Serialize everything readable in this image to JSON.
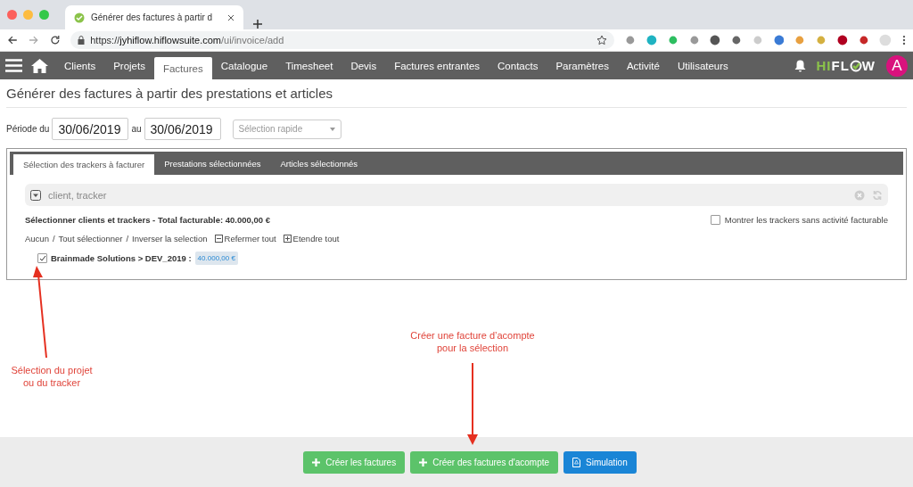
{
  "browser": {
    "tab_title": "Générer des factures à partir d",
    "url_scheme": "https://",
    "url_host": "jyhiflow.hiflowsuite.com",
    "url_path": "/ui/invoice/add"
  },
  "nav": {
    "items": [
      {
        "label": "Clients",
        "selected": false
      },
      {
        "label": "Projets",
        "selected": false
      },
      {
        "label": "Factures",
        "selected": true
      },
      {
        "label": "Catalogue",
        "selected": false
      },
      {
        "label": "Timesheet",
        "selected": false
      },
      {
        "label": "Devis",
        "selected": false
      },
      {
        "label": "Factures entrantes",
        "selected": false
      },
      {
        "label": "Contacts",
        "selected": false
      },
      {
        "label": "Paramètres",
        "selected": false
      },
      {
        "label": "Activité",
        "selected": false
      },
      {
        "label": "Utilisateurs",
        "selected": false
      }
    ],
    "logo_parts": [
      {
        "kind": "text",
        "text": "HI",
        "color": "#8bc34a"
      },
      {
        "kind": "text",
        "text": "FL",
        "color": "#ffffff"
      },
      {
        "kind": "check",
        "color": "#8bc34a"
      },
      {
        "kind": "text",
        "text": "W",
        "color": "#ffffff"
      }
    ],
    "avatar": "A"
  },
  "title": "Générer des factures à partir des prestations et articles",
  "period": {
    "label_from": "Période du",
    "from": "30/06/2019",
    "label_to": "au",
    "to": "30/06/2019",
    "quick_select_placeholder": "Sélection rapide"
  },
  "panel": {
    "tabs": [
      {
        "label": "Sélection des trackers à facturer",
        "selected": true
      },
      {
        "label": "Prestations sélectionnées",
        "selected": false
      },
      {
        "label": "Articles sélectionnés",
        "selected": false
      }
    ],
    "search_placeholder": "client, tracker",
    "summary": "Sélectionner clients et trackers - Total facturable: 40.000,00 €",
    "show_inactive": {
      "label": "Montrer les trackers sans activité facturable",
      "checked": false
    },
    "selection_links": [
      "Aucun",
      "Tout sélectionner",
      "Inverser la selection"
    ],
    "separator": "/",
    "collapse_all": "Refermer tout",
    "expand_all": "Etendre tout",
    "trackers": [
      {
        "label": "Brainmade Solutions > DEV_2019 :",
        "amount": "40.000,00 €",
        "checked": true
      }
    ]
  },
  "annotations": [
    {
      "lines": [
        "Sélection du projet",
        "ou du tracker"
      ],
      "kind": "arrow_up"
    },
    {
      "lines": [
        "Créer une facture d’acompte",
        "pour la sélection"
      ],
      "kind": "arrow_down"
    }
  ],
  "footer_buttons": [
    {
      "label": "Créer les factures",
      "kind": "create"
    },
    {
      "label": "Créer des factures d'acompte",
      "kind": "create"
    },
    {
      "label": "Simulation",
      "kind": "pdf"
    }
  ]
}
